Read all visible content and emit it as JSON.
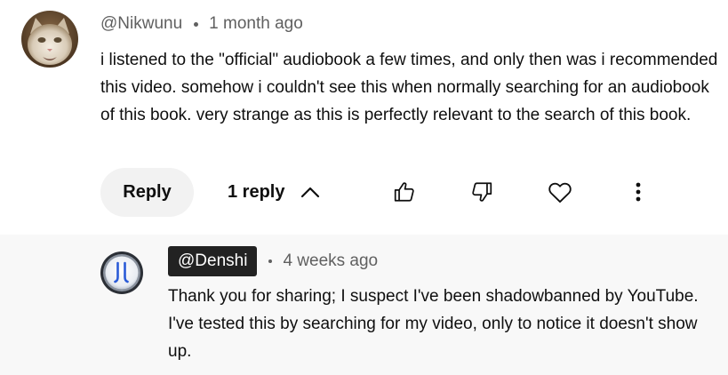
{
  "comment": {
    "author": "@Nikwunu",
    "time": "1 month ago",
    "text": "i listened to the \"official\" audiobook a few times, and only then was i recommended this video. somehow i couldn't see this when normally searching for an audiobook of this book. very strange as this is perfectly relevant to the search of this book.",
    "avatar_icon": "cat-photo-avatar",
    "actions": {
      "reply_label": "Reply",
      "replies_label": "1 reply",
      "replies_toggle_icon": "chevron-up-icon",
      "like_icon": "thumbs-up-icon",
      "dislike_icon": "thumbs-down-icon",
      "heart_icon": "heart-icon",
      "more_icon": "more-vert-icon"
    }
  },
  "reply": {
    "author": "@Denshi",
    "time": "4 weeks ago",
    "text": "Thank you for sharing; I suspect I've been shadowbanned by YouTube. I've tested this by searching for my video, only to notice it doesn't show up.",
    "avatar_icon": "denshi-logo-avatar"
  },
  "colors": {
    "text_primary": "#0f0f0f",
    "text_secondary": "#606060",
    "reply_background": "#f8f8f8",
    "reply_button_background": "#f2f2f2",
    "author_chip_background": "#222222"
  }
}
